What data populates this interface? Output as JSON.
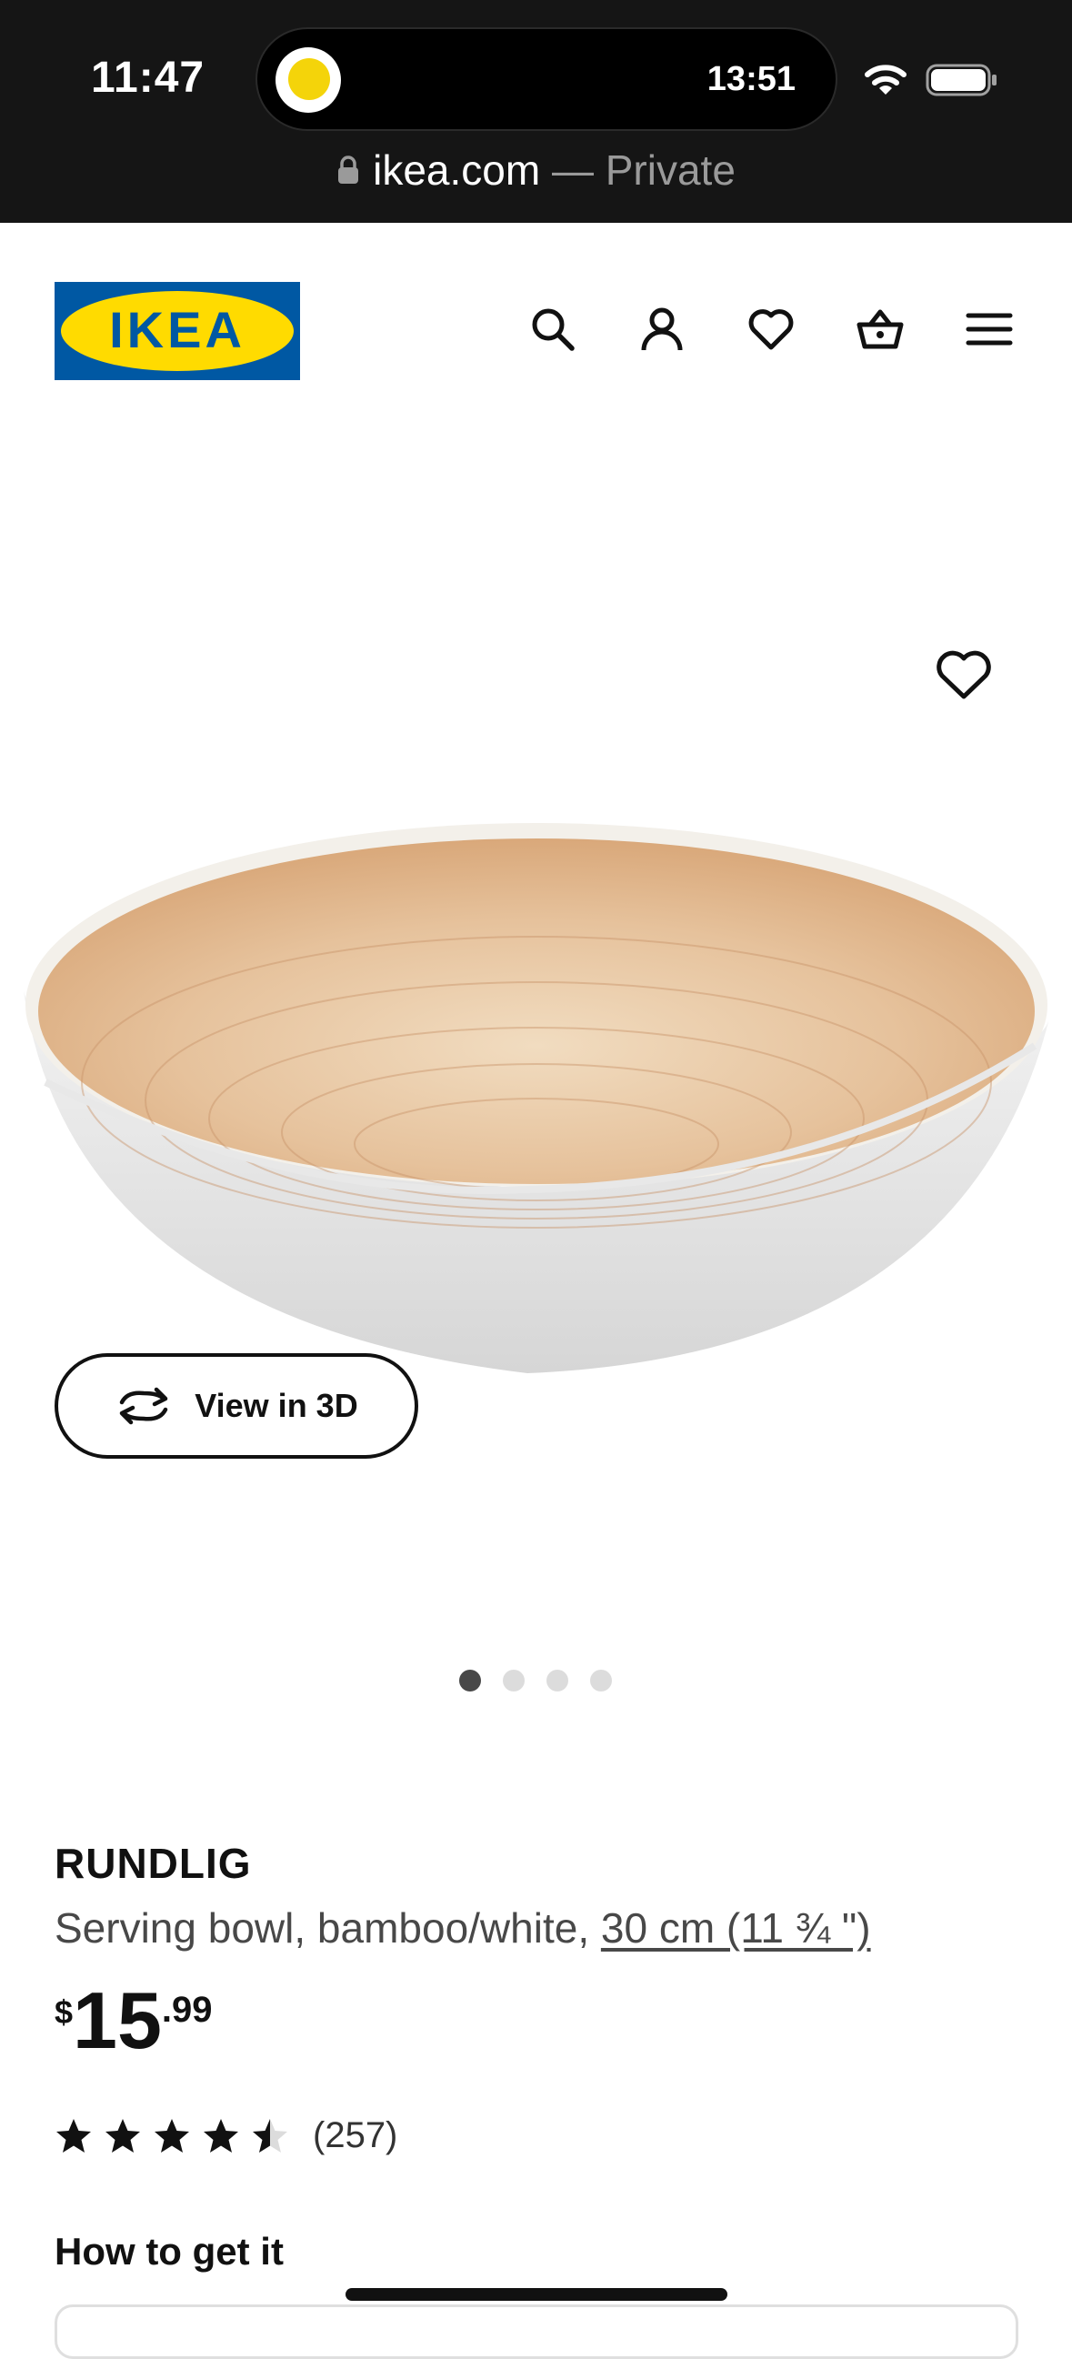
{
  "status_bar": {
    "time": "11:47",
    "island_time": "13:51"
  },
  "browser": {
    "domain": "ikea.com",
    "separator": " — ",
    "mode": "Private"
  },
  "header": {
    "logo_text": "IKEA",
    "icons": [
      "search-icon",
      "account-icon",
      "favourites-icon",
      "cart-icon",
      "menu-icon"
    ]
  },
  "gallery": {
    "view_3d_label": "View in 3D",
    "image_count": 4,
    "active_image": 1
  },
  "product": {
    "name": "RUNDLIG",
    "description": "Serving bowl, bamboo/white, ",
    "size_link": "30 cm (11 ¾ \")",
    "price_currency": "$",
    "price_integer": "15",
    "price_decimal": ".99",
    "rating": 4.5,
    "rating_max": 5,
    "review_count": "(257)"
  },
  "delivery": {
    "heading": "How to get it"
  },
  "colors": {
    "ikea_blue": "#0058a3",
    "ikea_yellow": "#ffdb00",
    "chrome": "#151515"
  }
}
